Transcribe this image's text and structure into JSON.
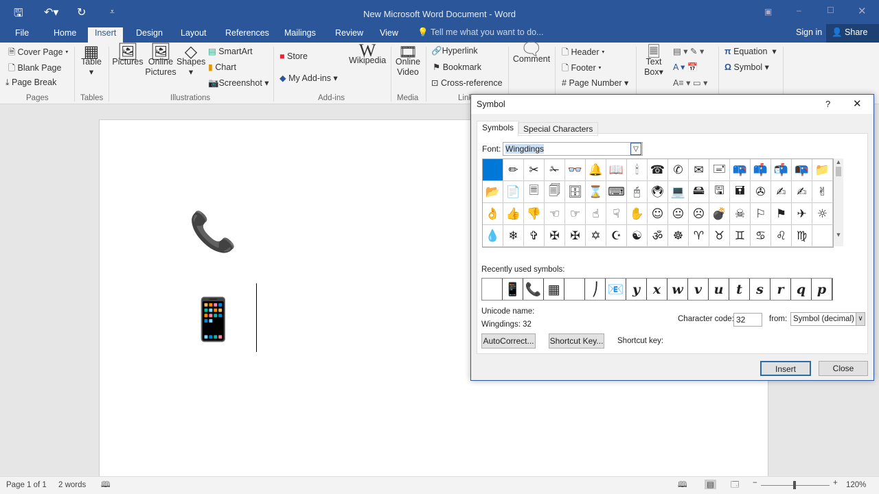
{
  "window": {
    "title": "New Microsoft Word Document - Word",
    "sign_in": "Sign in",
    "share": "Share"
  },
  "tabs": [
    "File",
    "Home",
    "Insert",
    "Design",
    "Layout",
    "References",
    "Mailings",
    "Review",
    "View"
  ],
  "active_tab": "Insert",
  "tell_me": "Tell me what you want to do...",
  "ribbon": {
    "pages": {
      "cover": "Cover Page",
      "blank": "Blank Page",
      "break": "Page Break",
      "label": "Pages"
    },
    "tables": {
      "table": "Table",
      "label": "Tables"
    },
    "illustrations": {
      "pictures": "Pictures",
      "online": "Online",
      "online2": "Pictures",
      "shapes": "Shapes",
      "smartart": "SmartArt",
      "chart": "Chart",
      "screenshot": "Screenshot",
      "label": "Illustrations"
    },
    "addins": {
      "store": "Store",
      "my": "My Add-ins",
      "wiki": "Wikipedia",
      "label": "Add-ins"
    },
    "media": {
      "online": "Online",
      "video": "Video",
      "label": "Media"
    },
    "links": {
      "hyperlink": "Hyperlink",
      "bookmark": "Bookmark",
      "xref": "Cross-reference",
      "label": "Link"
    },
    "comment": "Comment",
    "hf": {
      "header": "Header",
      "footer": "Footer",
      "pagenum": "Page Number"
    },
    "text": {
      "textbox": "Text",
      "textbox2": "Box"
    },
    "symbols": {
      "equation": "Equation",
      "symbol": "Symbol"
    }
  },
  "document": {
    "symbols": [
      "📞",
      "📱"
    ]
  },
  "status": {
    "page": "Page 1 of 1",
    "words": "2 words",
    "zoom": "120%",
    "zoom_level": 120
  },
  "dialog": {
    "title": "Symbol",
    "help": "?",
    "tabs": [
      "Symbols",
      "Special Characters"
    ],
    "font_label": "Font:",
    "font_value": "Wingdings",
    "symbols": [
      [
        " ",
        "✏",
        "✂",
        "✁",
        "👓",
        "🔔",
        "📖",
        "🕯",
        "☎",
        "✆",
        "✉",
        "🖃",
        "📪",
        "📫",
        "📬",
        "📭",
        "📁"
      ],
      [
        "📂",
        "📄",
        "🗏",
        "🗐",
        "🗄",
        "⌛",
        "⌨",
        "🖰",
        "🖲",
        "💻",
        "🖴",
        "🖫",
        "🖬",
        "✇",
        "✍",
        "✍",
        "✌"
      ],
      [
        "👌",
        "👍",
        "👎",
        "☜",
        "☞",
        "☝",
        "☟",
        "✋",
        "☺",
        "😐",
        "☹",
        "💣",
        "☠",
        "⚐",
        "⚑",
        "✈",
        "☼"
      ],
      [
        "💧",
        "❄",
        "✞",
        "✠",
        "✠",
        "✡",
        "☪",
        "☯",
        "ॐ",
        "☸",
        "♈",
        "♉",
        "♊",
        "♋",
        "♌",
        "♍",
        ""
      ]
    ],
    "recent_label": "Recently used symbols:",
    "recent": [
      "",
      " 📱",
      "📞",
      "▦",
      "",
      "⎠",
      "📧",
      "y",
      "x",
      "w",
      "v",
      "u",
      "t",
      "s",
      "r",
      "q",
      "p"
    ],
    "unicode_name_label": "Unicode name:",
    "unicode_value": "Wingdings: 32",
    "char_code_label": "Character code:",
    "char_code": "32",
    "from_label": "from:",
    "from_value": "Symbol (decimal)",
    "autocorrect": "AutoCorrect...",
    "shortcut_key_btn": "Shortcut Key...",
    "shortcut_key_label": "Shortcut key:",
    "insert": "Insert",
    "close": "Close"
  }
}
